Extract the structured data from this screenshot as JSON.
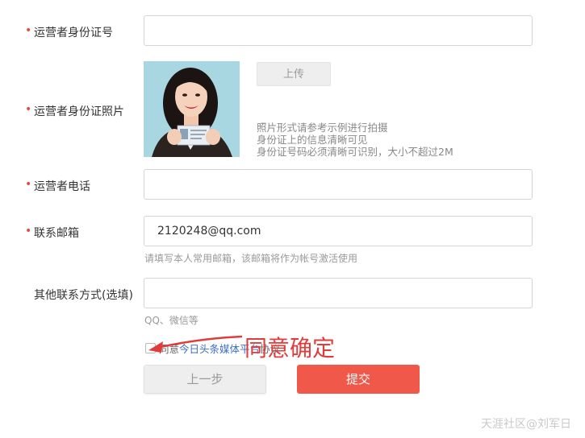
{
  "form": {
    "operator_id_label": "运营者身份证号",
    "operator_id_value": "",
    "operator_photo_label": "运营者身份证照片",
    "upload_button": "上传",
    "photo_notes": [
      "照片形式请参考示例进行拍摄",
      "身份证上的信息清晰可见",
      "身份证号码必须清晰可识别，大小不超过2M"
    ],
    "phone_label": "运营者电话",
    "phone_value": "",
    "email_label": "联系邮箱",
    "email_value": "2120248@qq.com",
    "email_hint": "请填写本人常用邮箱，该邮箱将作为帐号激活使用",
    "other_contact_label": "其他联系方式(选填)",
    "other_contact_value": "",
    "other_contact_hint": "QQ、微信等",
    "agree_prefix": "同意",
    "agree_link": "今日头条媒体平台",
    "agree_suffix": "协议"
  },
  "buttons": {
    "prev": "上一步",
    "submit": "提交"
  },
  "annotation": "同意确定",
  "watermark": "天涯社区@刘军日",
  "colors": {
    "required_dot": "#e64c3c",
    "submit_bg": "#f0584a",
    "annotation": "#e03c3c",
    "link": "#3a6fc4"
  },
  "icons": {
    "annotation_arrow": "arrow-icon",
    "checkbox": "checkbox-icon"
  }
}
